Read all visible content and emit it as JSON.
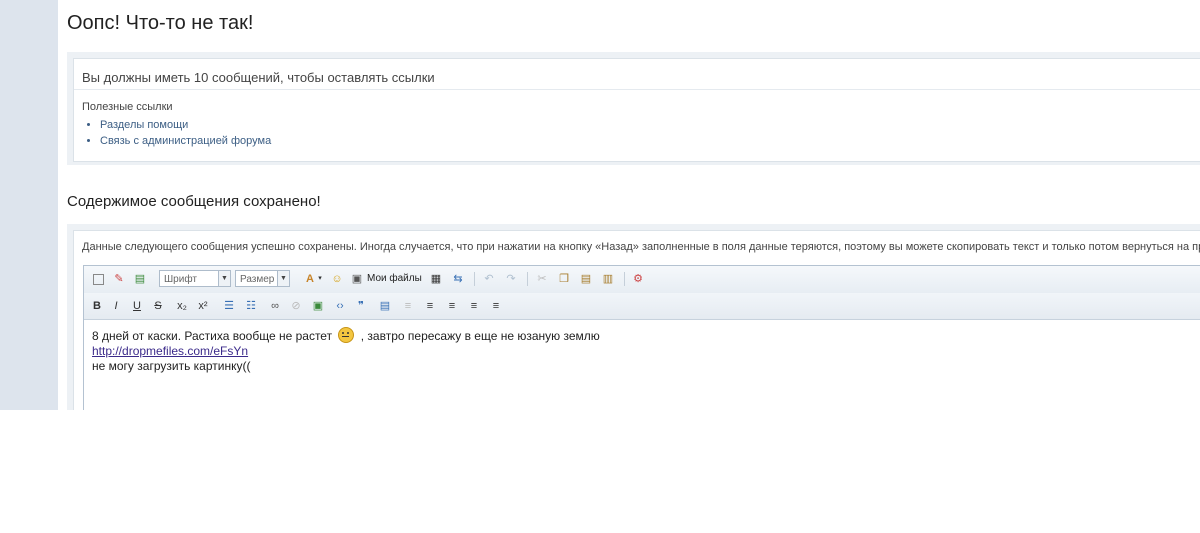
{
  "error": {
    "title": "Оопс! Что-то не так!",
    "message": "Вы должны иметь 10 сообщений, чтобы оставлять ссылки",
    "useful_links_label": "Полезные ссылки",
    "links": [
      "Разделы помощи",
      "Связь с администрацией форума"
    ]
  },
  "saved": {
    "title": "Содержимое сообщения сохранено!",
    "note": "Данные следующего сообщения успешно сохранены. Иногда случается, что при нажатии на кнопку «Назад» заполненные в поля данные теряются, поэтому вы можете скопировать текст и только потом вернуться на преды"
  },
  "editor": {
    "font_select": "Шрифт",
    "size_select": "Размер",
    "my_files_label": "Мои файлы",
    "content": {
      "line1_before": "8 дней от каски. Растиха вообще не растет",
      "line1_after": ", завтро пересажу в еще не юзаную землю",
      "link": "http://dropmefiles.com/eFsYn",
      "line3": "не могу загрузить картинку(("
    }
  },
  "colors": {
    "left_rail": "#dde4ed",
    "panel_bg": "#edf1f5",
    "link": "#3c5e84"
  }
}
